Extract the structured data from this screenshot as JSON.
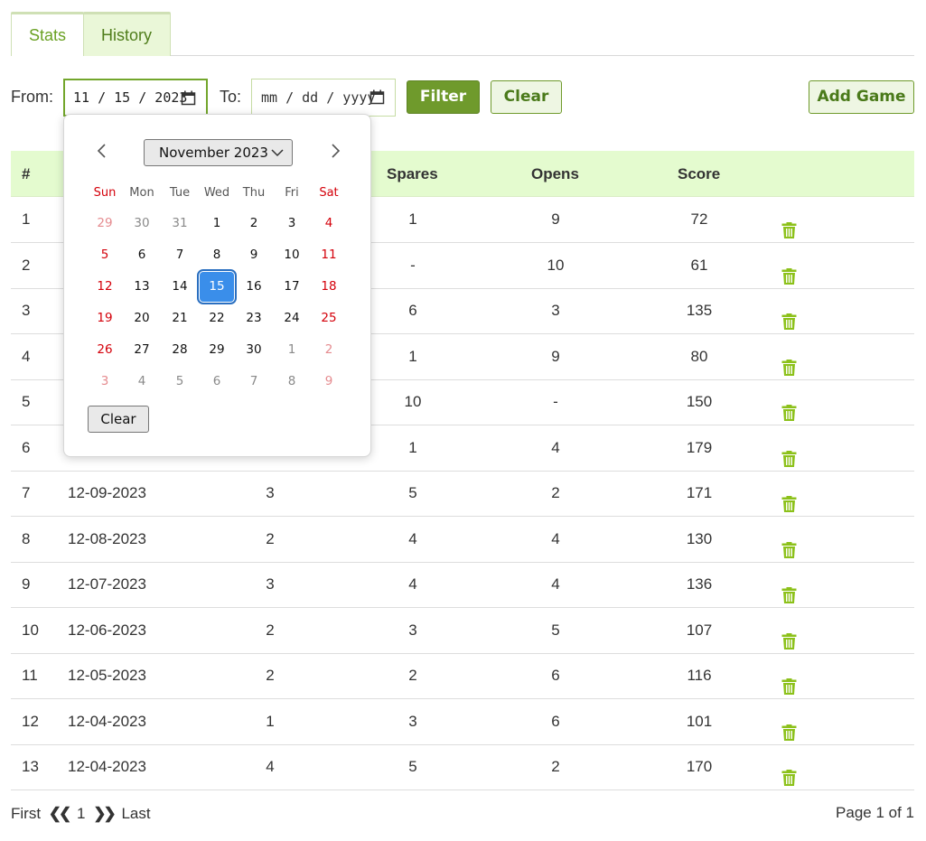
{
  "tabs": [
    {
      "label": "Stats",
      "active": false
    },
    {
      "label": "History",
      "active": true
    }
  ],
  "filter": {
    "from_label": "From:",
    "from_value": "11 / 15 / 2023",
    "to_label": "To:",
    "to_placeholder": "mm / dd / yyyy",
    "filter_button": "Filter",
    "clear_button": "Clear",
    "add_button": "Add Game"
  },
  "table": {
    "headers": {
      "num": "#",
      "spares": "Spares",
      "opens": "Opens",
      "score": "Score"
    },
    "rows": [
      {
        "num": "1",
        "date": "",
        "strikes": "",
        "spares": "1",
        "opens": "9",
        "score": "72"
      },
      {
        "num": "2",
        "date": "",
        "strikes": "",
        "spares": "-",
        "opens": "10",
        "score": "61"
      },
      {
        "num": "3",
        "date": "",
        "strikes": "",
        "spares": "6",
        "opens": "3",
        "score": "135"
      },
      {
        "num": "4",
        "date": "",
        "strikes": "",
        "spares": "1",
        "opens": "9",
        "score": "80"
      },
      {
        "num": "5",
        "date": "",
        "strikes": "",
        "spares": "10",
        "opens": "-",
        "score": "150"
      },
      {
        "num": "6",
        "date": "",
        "strikes": "",
        "spares": "1",
        "opens": "4",
        "score": "179"
      },
      {
        "num": "7",
        "date": "12-09-2023",
        "strikes": "3",
        "spares": "5",
        "opens": "2",
        "score": "171"
      },
      {
        "num": "8",
        "date": "12-08-2023",
        "strikes": "2",
        "spares": "4",
        "opens": "4",
        "score": "130"
      },
      {
        "num": "9",
        "date": "12-07-2023",
        "strikes": "3",
        "spares": "4",
        "opens": "4",
        "score": "136"
      },
      {
        "num": "10",
        "date": "12-06-2023",
        "strikes": "2",
        "spares": "3",
        "opens": "5",
        "score": "107"
      },
      {
        "num": "11",
        "date": "12-05-2023",
        "strikes": "2",
        "spares": "2",
        "opens": "6",
        "score": "116"
      },
      {
        "num": "12",
        "date": "12-04-2023",
        "strikes": "1",
        "spares": "3",
        "opens": "6",
        "score": "101"
      },
      {
        "num": "13",
        "date": "12-04-2023",
        "strikes": "4",
        "spares": "5",
        "opens": "2",
        "score": "170"
      }
    ]
  },
  "pagination": {
    "first": "First",
    "current": "1",
    "last": "Last",
    "info": "Page 1 of 1"
  },
  "calendar": {
    "month_label": "November 2023",
    "weekdays": [
      "Sun",
      "Mon",
      "Tue",
      "Wed",
      "Thu",
      "Fri",
      "Sat"
    ],
    "weeks": [
      [
        "29",
        "30",
        "31",
        "1",
        "2",
        "3",
        "4"
      ],
      [
        "5",
        "6",
        "7",
        "8",
        "9",
        "10",
        "11"
      ],
      [
        "12",
        "13",
        "14",
        "15",
        "16",
        "17",
        "18"
      ],
      [
        "19",
        "20",
        "21",
        "22",
        "23",
        "24",
        "25"
      ],
      [
        "26",
        "27",
        "28",
        "29",
        "30",
        "1",
        "2"
      ],
      [
        "3",
        "4",
        "5",
        "6",
        "7",
        "8",
        "9"
      ]
    ],
    "selected_day": "15",
    "clear_label": "Clear"
  },
  "colors": {
    "accent": "#6f9a2c",
    "header_bg": "#e4fbcf",
    "trash": "#8cc11a",
    "weekend": "#d4000a",
    "selected_day": "#3a8eea"
  }
}
